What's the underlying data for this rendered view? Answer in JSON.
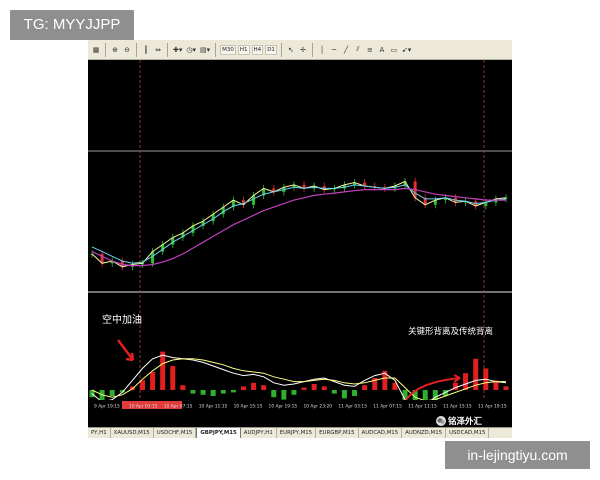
{
  "watermarks": {
    "top_left": "TG: MYYJJPP",
    "bottom_right": "in-lejingtiyu.com"
  },
  "toolbar": {
    "timeframes": [
      "M30",
      "H1",
      "H4",
      "D1"
    ],
    "icons": [
      "new-chart-icon",
      "zoom-in-icon",
      "zoom-out-icon",
      "chart-bars-icon",
      "indicators-icon",
      "clock-icon",
      "template-icon",
      "cursor-icon",
      "crosshair-icon",
      "vertical-line-icon",
      "horizontal-line-icon",
      "trendline-icon",
      "fibonacci-icon",
      "text-icon",
      "label-icon",
      "arrow-icon"
    ],
    "text_tool_label": "A"
  },
  "annotations": {
    "left": "空中加油",
    "right": "关键形背离及传统背离"
  },
  "logo": {
    "text": "铭泽外汇"
  },
  "time_axis": {
    "labels": [
      "9 Apr 19:15",
      "10 Apr 03:15",
      "10 Apr 07:15",
      "10 Apr 11:15",
      "10 Apr 15:15",
      "10 Apr 19:15",
      "10 Apr 23:20",
      "11 Apr 03:15",
      "11 Apr 07:15",
      "11 Apr 11:15",
      "11 Apr 15:15",
      "11 Apr 19:15"
    ],
    "highlight_color": "#e23b3b"
  },
  "tabs": [
    {
      "label": "PY,H1",
      "active": false
    },
    {
      "label": "XAUUSD,M15",
      "active": false
    },
    {
      "label": "USDCHF,M15",
      "active": false
    },
    {
      "label": "GBPJPY,M15",
      "active": true
    },
    {
      "label": "AUDJPY,H1",
      "active": false
    },
    {
      "label": "EURJPY,M15",
      "active": false
    },
    {
      "label": "EURGBP,M15",
      "active": false
    },
    {
      "label": "AUDCAD,M15",
      "active": false
    },
    {
      "label": "AUDNZD,M15",
      "active": false
    },
    {
      "label": "USDCAD,M15",
      "active": false
    }
  ],
  "colors": {
    "up_candle": "#2fbf2f",
    "down_candle": "#e03030",
    "fast_ma": "#f5f5a0",
    "mid_ma": "#6ad0f0",
    "slow_ma": "#c040c0",
    "macd_pos": "#e02020",
    "macd_neg": "#2fae2f",
    "macd_line": "#ffffff",
    "signal_line": "#ffff80",
    "grid": "#c0c0c0"
  },
  "chart_data": {
    "type": "line",
    "title": "",
    "price_series": [
      {
        "values": [
          0.1,
          -0.3,
          -0.2,
          -0.45,
          -0.35,
          -0.3,
          0.2,
          0.5,
          0.8,
          1.0,
          1.3,
          1.5,
          1.8,
          2.1,
          2.4,
          2.2,
          2.6,
          2.9,
          2.75,
          2.95,
          3.05,
          2.9,
          3.0,
          2.85,
          2.9,
          3.05,
          3.15,
          3.0,
          2.95,
          2.9,
          3.0,
          3.2,
          2.5,
          2.2,
          2.4,
          2.5,
          2.3,
          2.35,
          2.15,
          2.3,
          2.45,
          2.5
        ]
      },
      {
        "values": [
          0.4,
          0.2,
          0.0,
          -0.2,
          -0.3,
          -0.25,
          0.0,
          0.3,
          0.6,
          0.85,
          1.1,
          1.35,
          1.6,
          1.9,
          2.15,
          2.25,
          2.45,
          2.65,
          2.75,
          2.85,
          2.95,
          2.9,
          2.95,
          2.9,
          2.9,
          2.95,
          3.05,
          3.0,
          2.95,
          2.9,
          2.95,
          3.05,
          2.7,
          2.45,
          2.45,
          2.5,
          2.4,
          2.35,
          2.25,
          2.3,
          2.4,
          2.45
        ]
      },
      {
        "values": [
          0.2,
          0.0,
          -0.2,
          -0.35,
          -0.4,
          -0.4,
          -0.35,
          -0.25,
          -0.1,
          0.1,
          0.35,
          0.6,
          0.85,
          1.1,
          1.35,
          1.55,
          1.75,
          1.95,
          2.1,
          2.25,
          2.4,
          2.5,
          2.6,
          2.65,
          2.7,
          2.75,
          2.8,
          2.85,
          2.85,
          2.85,
          2.85,
          2.9,
          2.85,
          2.75,
          2.65,
          2.6,
          2.55,
          2.5,
          2.45,
          2.4,
          2.4,
          2.4
        ]
      }
    ],
    "macd_histogram": [
      -0.6,
      -0.9,
      -0.5,
      -0.2,
      0.3,
      0.8,
      1.5,
      3.2,
      2.0,
      0.4,
      -0.3,
      -0.4,
      -0.5,
      -0.3,
      -0.2,
      0.3,
      0.6,
      0.4,
      -0.6,
      -0.8,
      -0.4,
      0.2,
      0.5,
      0.3,
      -0.3,
      -0.7,
      -0.5,
      0.4,
      1.0,
      1.6,
      0.6,
      -1.5,
      -2.2,
      -1.8,
      -1.0,
      -0.5,
      0.6,
      1.4,
      2.6,
      1.8,
      0.8,
      0.3
    ],
    "macd_line": [
      -0.3,
      -1.0,
      -0.8,
      -0.2,
      0.8,
      1.8,
      2.6,
      2.9,
      2.7,
      2.6,
      2.5,
      2.3,
      2.0,
      1.7,
      1.4,
      1.2,
      1.3,
      1.1,
      0.6,
      0.4,
      0.5,
      0.7,
      0.9,
      1.0,
      0.7,
      0.4,
      0.3,
      0.8,
      1.2,
      1.4,
      0.8,
      -0.8,
      -1.6,
      -1.2,
      -0.6,
      -0.2,
      0.2,
      0.5,
      0.8,
      0.9,
      0.7,
      0.6
    ],
    "signal_line": [
      0.0,
      -0.4,
      -0.6,
      -0.4,
      0.1,
      0.9,
      1.6,
      2.2,
      2.5,
      2.6,
      2.6,
      2.5,
      2.3,
      2.1,
      1.8,
      1.6,
      1.5,
      1.4,
      1.1,
      0.9,
      0.7,
      0.7,
      0.8,
      0.9,
      0.8,
      0.6,
      0.5,
      0.6,
      0.8,
      1.0,
      1.0,
      0.2,
      -0.6,
      -0.9,
      -0.8,
      -0.5,
      -0.2,
      0.1,
      0.4,
      0.6,
      0.7,
      0.7
    ]
  }
}
